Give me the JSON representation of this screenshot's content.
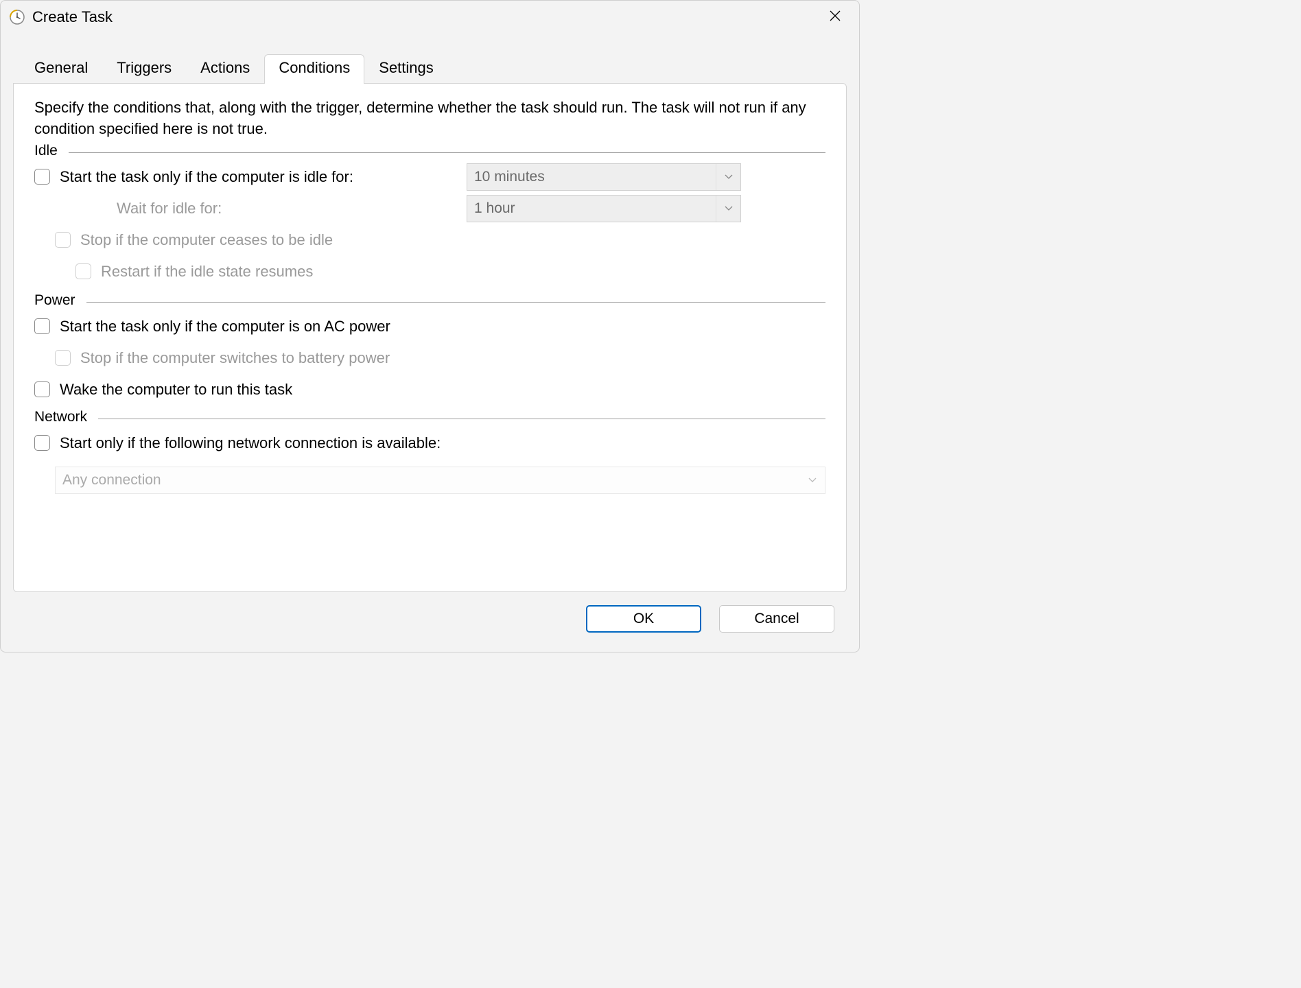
{
  "window": {
    "title": "Create Task"
  },
  "tabs": {
    "general": "General",
    "triggers": "Triggers",
    "actions": "Actions",
    "conditions": "Conditions",
    "settings": "Settings"
  },
  "intro": "Specify the conditions that, along with the trigger, determine whether the task should run.  The task will not run  if any condition specified here is not true.",
  "sections": {
    "idle": {
      "label": "Idle",
      "start_idle": "Start the task only if the computer is idle for:",
      "idle_duration": "10 minutes",
      "wait_label": "Wait for idle for:",
      "wait_duration": "1 hour",
      "stop_cease": "Stop if the computer ceases to be idle",
      "restart_resume": "Restart if the idle state resumes"
    },
    "power": {
      "label": "Power",
      "start_ac": "Start the task only if the computer is on AC power",
      "stop_battery": "Stop if the computer switches to battery power",
      "wake": "Wake the computer to run this task"
    },
    "network": {
      "label": "Network",
      "start_network": "Start only if the following network connection is available:",
      "connection": "Any connection"
    }
  },
  "buttons": {
    "ok": "OK",
    "cancel": "Cancel"
  }
}
